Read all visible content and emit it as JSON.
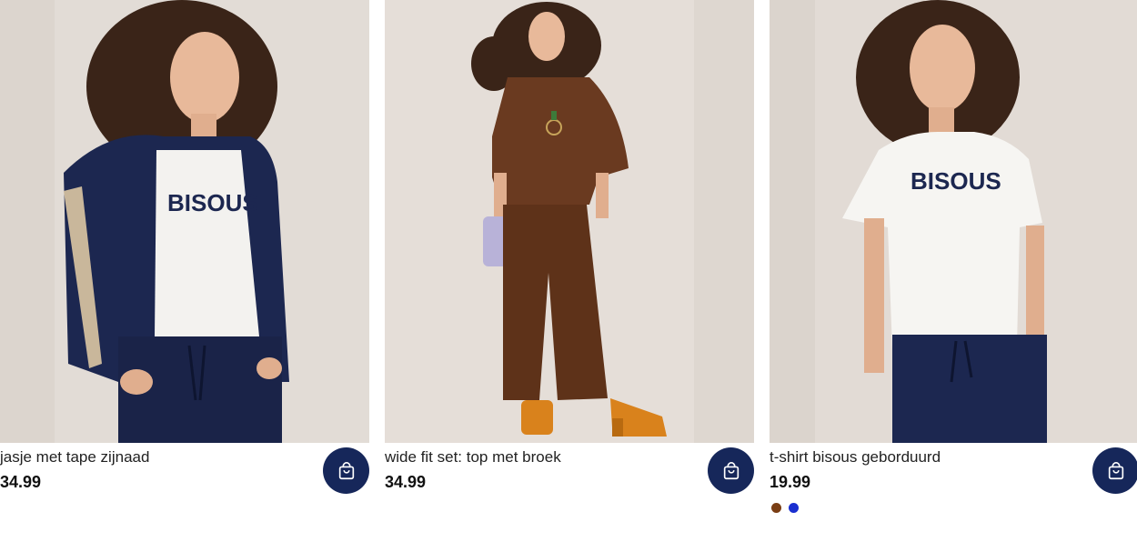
{
  "products": [
    {
      "title": "jasje met tape zijnaad",
      "price": "34.99",
      "image": "woman in navy zip jacket with side tape, white BISOUS t-shirt and navy joggers",
      "cart_icon": "shopping-bag-icon"
    },
    {
      "title": "wide fit set: top met broek",
      "price": "34.99",
      "image": "woman in brown oversized top and wide brown trousers with orange platform shoes",
      "cart_icon": "shopping-bag-icon"
    },
    {
      "title": "t-shirt bisous geborduurd",
      "price": "19.99",
      "image": "woman in white t-shirt with embroidered BISOUS text and navy trousers",
      "cart_icon": "shopping-bag-icon",
      "swatches": [
        "#7a3e14",
        "#1a2fd0"
      ]
    }
  ],
  "colors": {
    "cart_button": "#16275a",
    "photo_background": "#e4ddd8"
  }
}
